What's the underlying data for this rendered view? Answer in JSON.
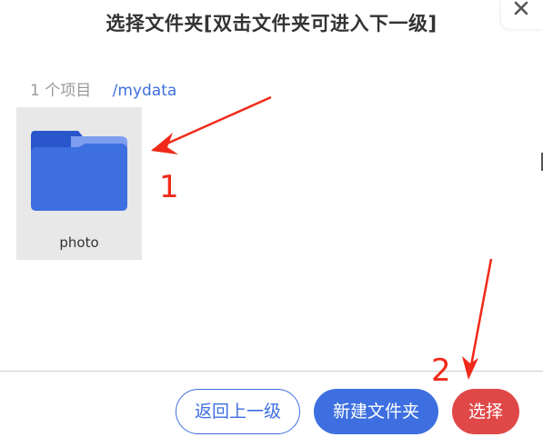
{
  "dialog": {
    "title": "选择文件夹[双击文件夹可进入下一级]",
    "close_icon": "close-icon"
  },
  "pathbar": {
    "item_count": "1 个项目",
    "path": "/mydata"
  },
  "folders": [
    {
      "name": "photo",
      "icon": "folder-icon"
    }
  ],
  "buttons": {
    "back_label": "返回上一级",
    "new_folder_label": "新建文件夹",
    "select_label": "选择"
  },
  "annotations": {
    "marker_1": "1",
    "marker_2": "2"
  },
  "colors": {
    "accent_blue": "#3d6fe0",
    "select_red": "#e04848",
    "annotation_red": "#f02a1a",
    "folder_tile_bg": "#e8e8e8"
  }
}
